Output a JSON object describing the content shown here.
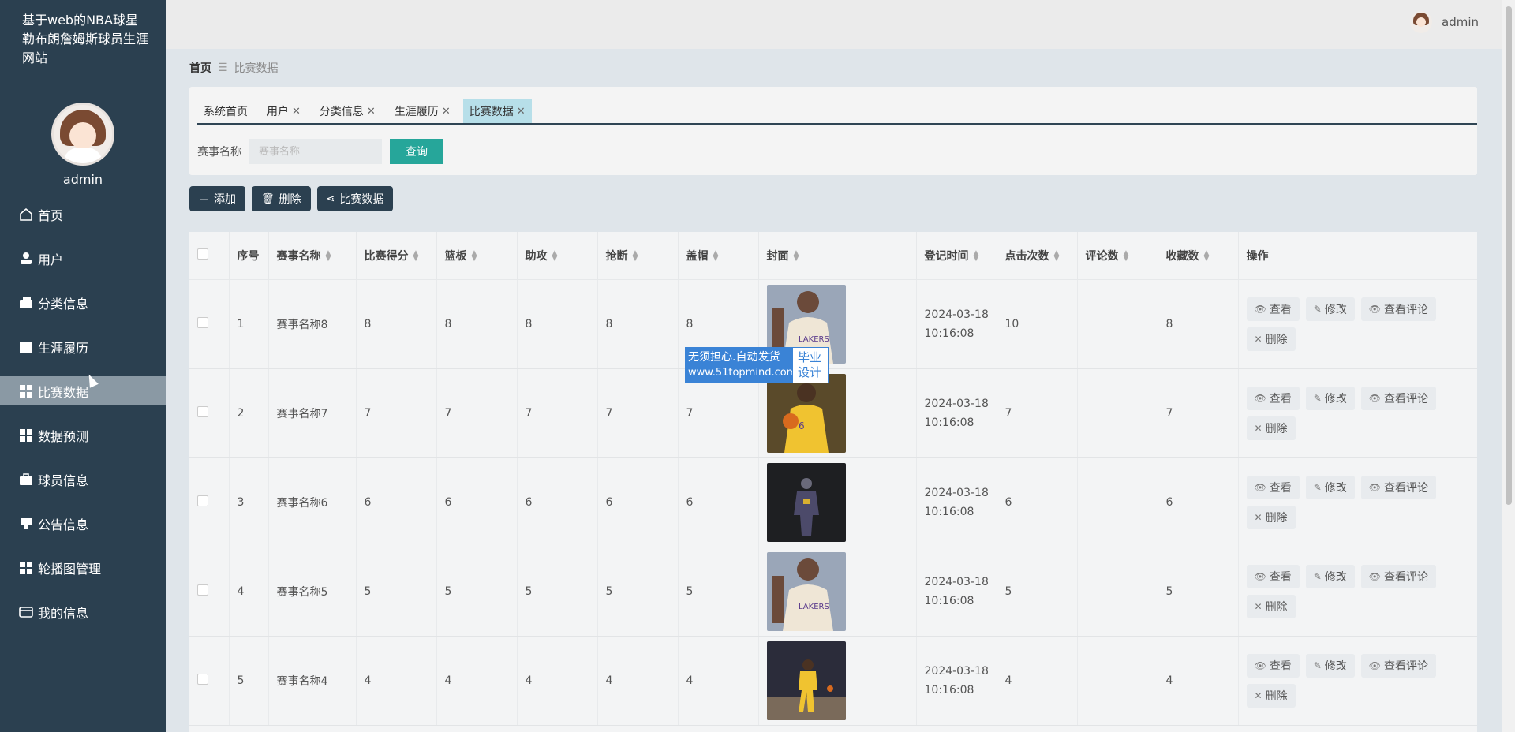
{
  "sidebar": {
    "site_title": "基于web的NBA球星勒布朗詹姆斯球员生涯网站",
    "admin_name": "admin",
    "menu": [
      {
        "label": "首页",
        "icon": "home-icon"
      },
      {
        "label": "用户",
        "icon": "user-icon"
      },
      {
        "label": "分类信息",
        "icon": "wallet-icon"
      },
      {
        "label": "生涯履历",
        "icon": "book-icon"
      },
      {
        "label": "比赛数据",
        "icon": "grid-icon",
        "active": true
      },
      {
        "label": "数据预测",
        "icon": "grid-icon"
      },
      {
        "label": "球员信息",
        "icon": "briefcase-icon"
      },
      {
        "label": "公告信息",
        "icon": "stamp-icon"
      },
      {
        "label": "轮播图管理",
        "icon": "grid-icon"
      },
      {
        "label": "我的信息",
        "icon": "card-icon"
      }
    ]
  },
  "topbar": {
    "user": "admin"
  },
  "breadcrumb": {
    "home": "首页",
    "current": "比赛数据"
  },
  "tabs": [
    {
      "label": "系统首页",
      "closable": false
    },
    {
      "label": "用户",
      "closable": true
    },
    {
      "label": "分类信息",
      "closable": true
    },
    {
      "label": "生涯履历",
      "closable": true
    },
    {
      "label": "比赛数据",
      "closable": true,
      "active": true
    }
  ],
  "search": {
    "label": "赛事名称",
    "placeholder": "赛事名称",
    "button": "查询"
  },
  "actions": {
    "add": "添加",
    "delete": "删除",
    "share": "比赛数据"
  },
  "table": {
    "headers": [
      "序号",
      "赛事名称",
      "比赛得分",
      "篮板",
      "助攻",
      "抢断",
      "盖帽",
      "封面",
      "登记时间",
      "点击次数",
      "评论数",
      "收藏数",
      "操作"
    ],
    "rows": [
      {
        "no": "1",
        "name": "赛事名称8",
        "score": "8",
        "rebound": "8",
        "assist": "8",
        "steal": "8",
        "block": "8",
        "time": "2024-03-18 10:16:08",
        "clicks": "10",
        "comments": "",
        "favorites": "8",
        "cover": "lakers-white"
      },
      {
        "no": "2",
        "name": "赛事名称7",
        "score": "7",
        "rebound": "7",
        "assist": "7",
        "steal": "7",
        "block": "7",
        "time": "2024-03-18 10:16:08",
        "clicks": "7",
        "comments": "",
        "favorites": "7",
        "cover": "lakers-yellow"
      },
      {
        "no": "3",
        "name": "赛事名称6",
        "score": "6",
        "rebound": "6",
        "assist": "6",
        "steal": "6",
        "block": "6",
        "time": "2024-03-18 10:16:08",
        "clicks": "6",
        "comments": "",
        "favorites": "6",
        "cover": "dark-figure"
      },
      {
        "no": "4",
        "name": "赛事名称5",
        "score": "5",
        "rebound": "5",
        "assist": "5",
        "steal": "5",
        "block": "5",
        "time": "2024-03-18 10:16:08",
        "clicks": "5",
        "comments": "",
        "favorites": "5",
        "cover": "lakers-white"
      },
      {
        "no": "5",
        "name": "赛事名称4",
        "score": "4",
        "rebound": "4",
        "assist": "4",
        "steal": "4",
        "block": "4",
        "time": "2024-03-18 10:16:08",
        "clicks": "4",
        "comments": "",
        "favorites": "4",
        "cover": "court"
      }
    ],
    "ops": {
      "view": "查看",
      "edit": "修改",
      "comments": "查看评论",
      "delete": "删除"
    }
  },
  "watermark": {
    "line1": "无须担心.自动发货",
    "line2": "www.51topmind.com",
    "right1": "毕业",
    "right2": "设计"
  }
}
